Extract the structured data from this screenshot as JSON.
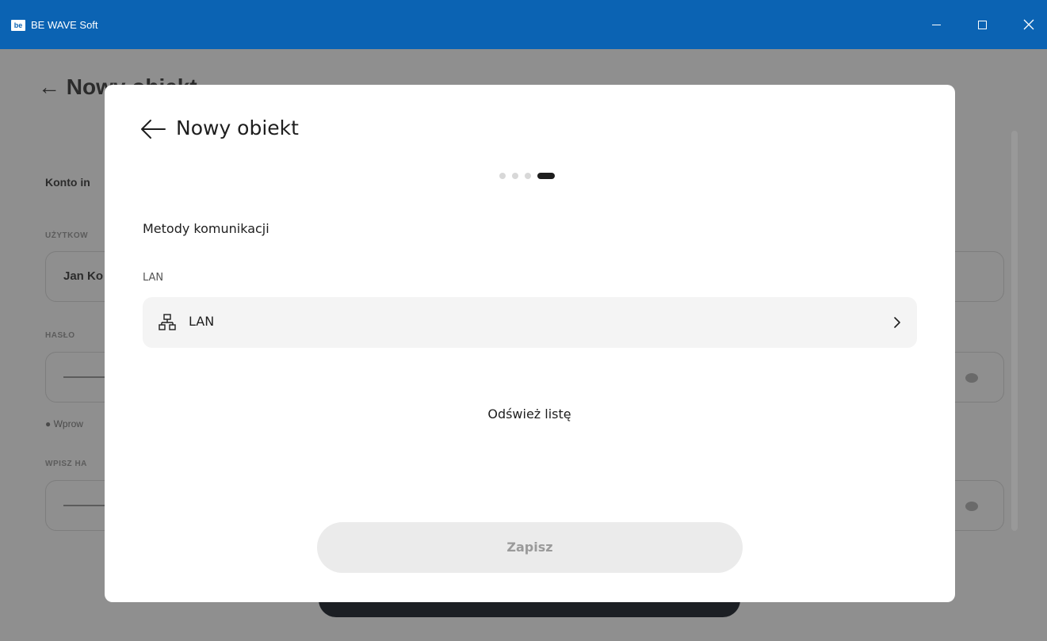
{
  "window": {
    "title": "BE WAVE Soft",
    "icon_text": "be"
  },
  "background_page": {
    "title": "← Nowy obiekt",
    "section_heading": "Konto in",
    "user_label": "UŻYTKOW",
    "user_value": "Jan Ko",
    "password_label": "HASŁO",
    "hint_text": "Wprow",
    "confirm_label": "WPISZ HA"
  },
  "modal": {
    "title": "Nowy obiekt",
    "steps_total": 4,
    "step_active": 4,
    "section_title": "Metody komunikacji",
    "group_label": "LAN",
    "item_label": "LAN",
    "refresh_label": "Odśwież listę",
    "save_label": "Zapisz"
  },
  "colors": {
    "titlebar": "#0b63b3",
    "overlay": "#8f8f8f",
    "modal_bg": "#ffffff",
    "row_bg": "#f4f4f4",
    "disabled_button": "#ebebeb"
  },
  "icons": {
    "back": "arrow-left-icon",
    "lan": "network-icon",
    "chevron": "chevron-right-icon"
  }
}
